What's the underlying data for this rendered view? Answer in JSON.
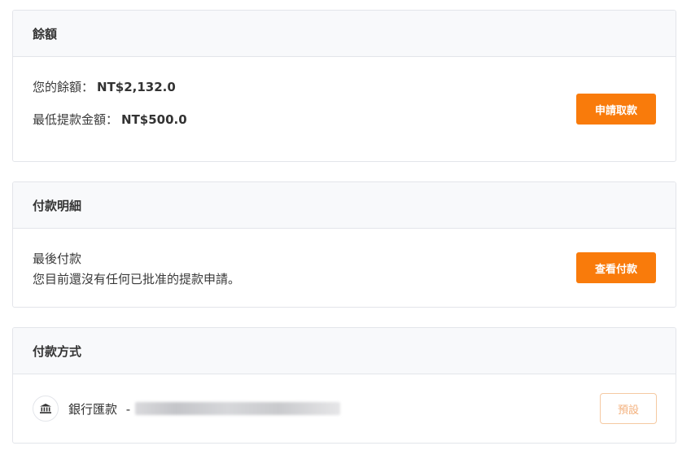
{
  "balance_card": {
    "title": "餘額",
    "balance_label": "您的餘額：",
    "balance_value": "NT$2,132.0",
    "min_withdraw_label": "最低提款金額：",
    "min_withdraw_value": "NT$500.0",
    "withdraw_button": "申請取款"
  },
  "payment_details_card": {
    "title": "付款明細",
    "last_payment_label": "最後付款",
    "no_payment_message": "您目前還沒有任何已批准的提款申請。",
    "view_payments_button": "查看付款"
  },
  "payment_method_card": {
    "title": "付款方式",
    "bank_icon": "bank-icon",
    "method_label": "銀行匯款",
    "separator": "-",
    "default_button": "預設"
  },
  "colors": {
    "accent": "#f97b0b",
    "header_bg": "#f8f9fb",
    "border": "#e3e5ea"
  }
}
